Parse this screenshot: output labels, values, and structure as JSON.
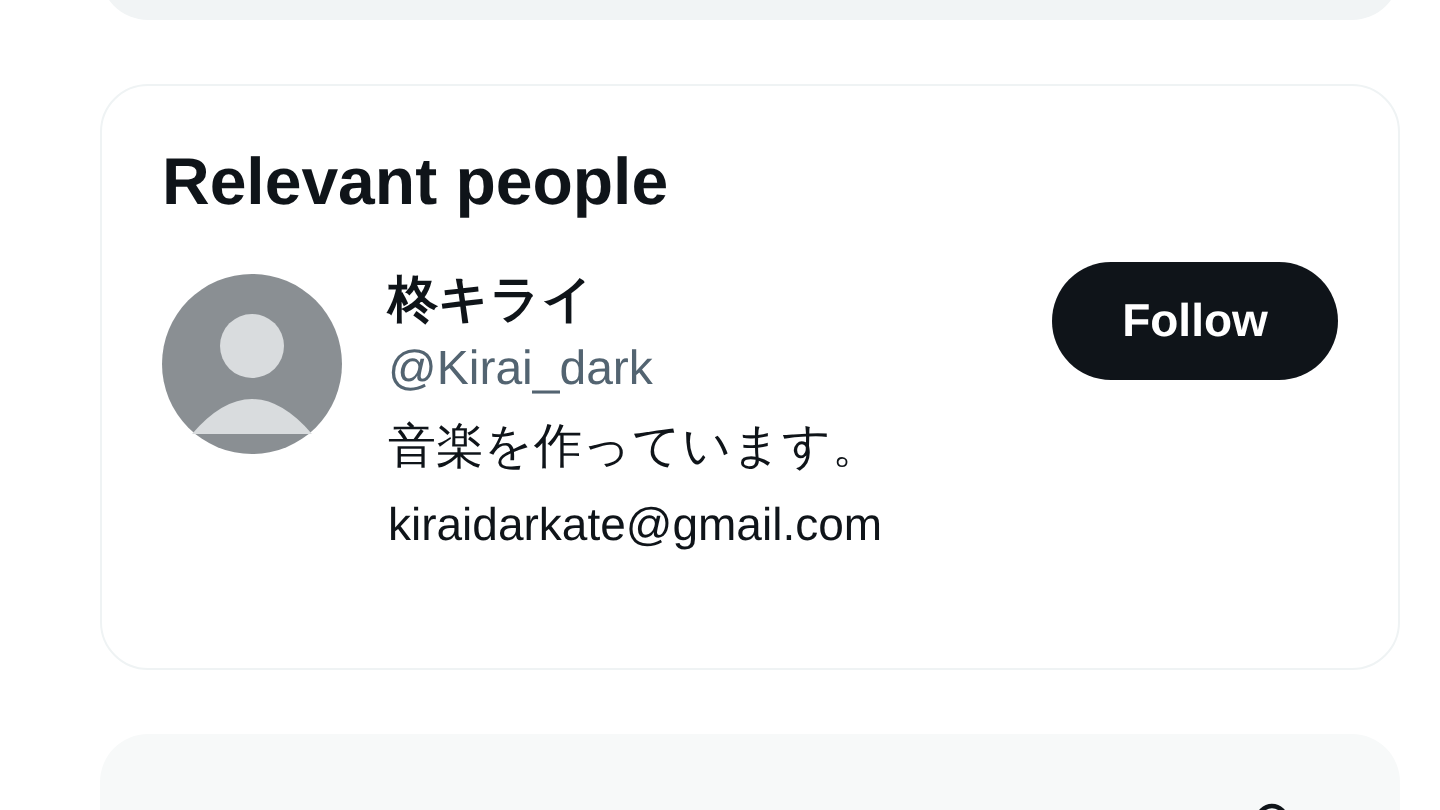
{
  "relevant_people": {
    "title": "Relevant people",
    "people": [
      {
        "name": "柊キライ",
        "handle": "@Kirai_dark",
        "bio": "音楽を作っています。",
        "email": "kiraidarkate@gmail.com",
        "follow_label": "Follow"
      }
    ]
  }
}
